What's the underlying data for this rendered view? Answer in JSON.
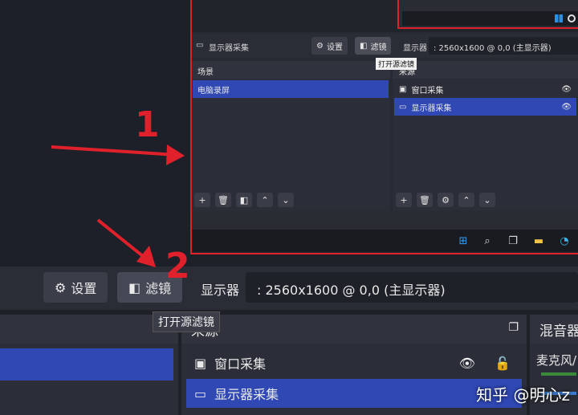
{
  "nested": {
    "source_title": "显示器采集",
    "settings_label": "设置",
    "filters_label": "滤镜",
    "display_label": "显示器",
    "display_value": ": 2560x1600 @ 0,0 (主显示器)",
    "tooltip": "打开源滤镜",
    "scenes_title": "场景",
    "sources_title": "来源",
    "scenes": [
      "电脑录屏"
    ],
    "sources": [
      "窗口采集",
      "显示器采集"
    ]
  },
  "main": {
    "settings_label": "设置",
    "filters_label": "滤镜",
    "display_label": "显示器",
    "display_value": ": 2560x1600 @ 0,0 (主显示器)",
    "tooltip": "打开源滤镜",
    "sources_title": "来源",
    "sources": [
      "窗口采集",
      "显示器采集"
    ],
    "mixer_title": "混音器",
    "mixer_channel": "麦克风/"
  },
  "annotations": {
    "num1": "1",
    "num2": "2"
  },
  "watermark": "知乎 @明心z",
  "colors": {
    "accent_red": "#e0202a",
    "selection": "#2f48b4"
  }
}
